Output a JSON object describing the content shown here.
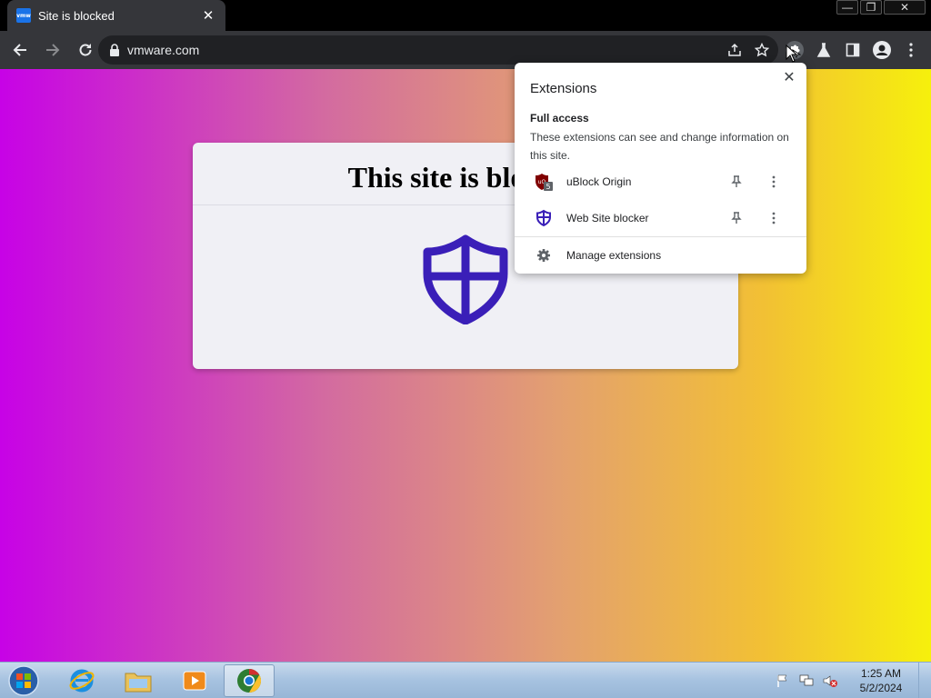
{
  "browser": {
    "tab": {
      "favicon_text": "vmw",
      "title": "Site is blocked",
      "close": "✕"
    },
    "window_controls": {
      "minimize": "—",
      "restore": "❐",
      "close": "✕"
    },
    "address": {
      "url": "vmware.com"
    }
  },
  "page": {
    "heading": "This site is blocked",
    "shield_color": "#3a1fb8",
    "background_colors": [
      "#c702e6",
      "#d36ba0",
      "#e3a070",
      "#f2c034",
      "#f6f00c"
    ]
  },
  "extensions_popup": {
    "title": "Extensions",
    "close": "✕",
    "section_title": "Full access",
    "section_desc": "These extensions can see and change information on this site.",
    "items": [
      {
        "name": "uBlock Origin",
        "icon": "ublock-icon",
        "badge": "5"
      },
      {
        "name": "Web Site blocker",
        "icon": "shield-icon"
      }
    ],
    "manage_label": "Manage extensions"
  },
  "taskbar": {
    "apps": [
      "internet-explorer-icon",
      "file-explorer-icon",
      "media-player-icon",
      "chrome-icon"
    ],
    "clock": {
      "time": "1:25 AM",
      "date": "5/2/2024"
    }
  }
}
